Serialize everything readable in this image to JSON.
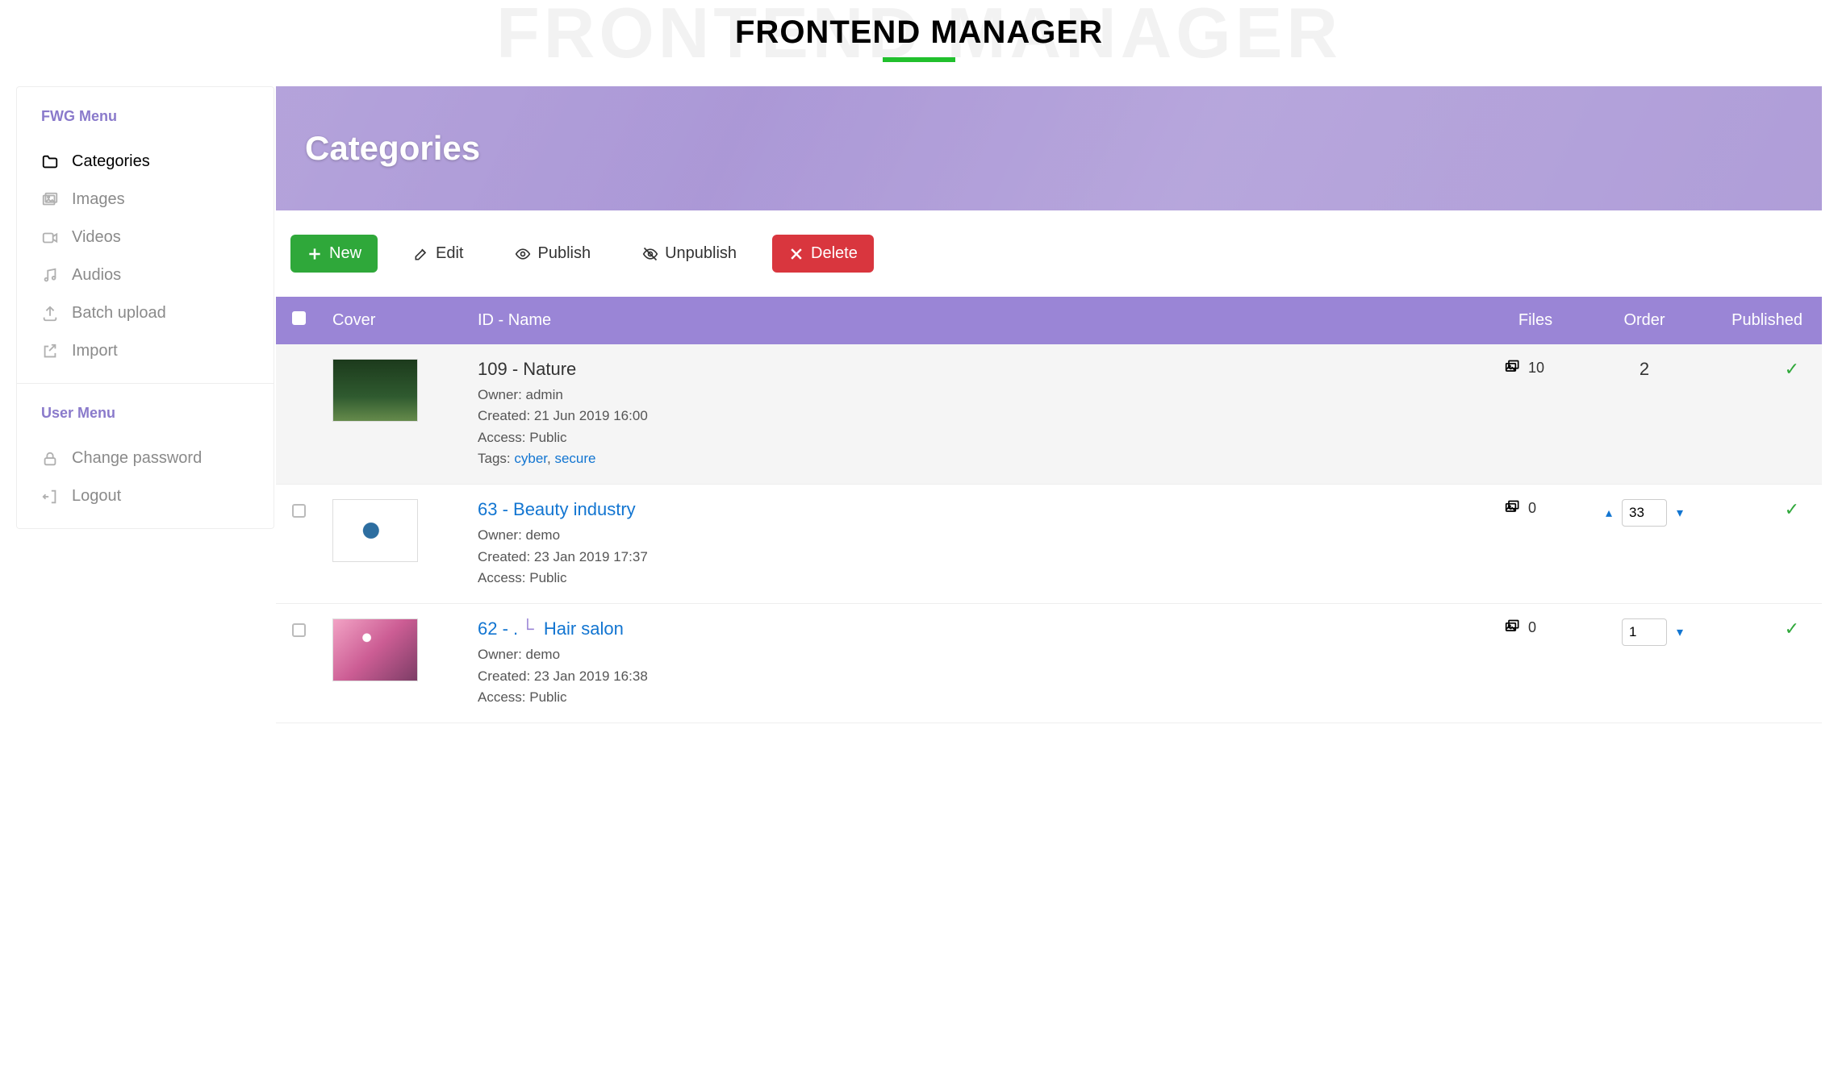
{
  "page": {
    "title": "FRONTEND MANAGER"
  },
  "sidebar": {
    "fwg_heading": "FWG Menu",
    "user_heading": "User Menu",
    "items": [
      {
        "label": "Categories",
        "icon": "folder-icon",
        "active": true
      },
      {
        "label": "Images",
        "icon": "images-icon",
        "active": false
      },
      {
        "label": "Videos",
        "icon": "video-icon",
        "active": false
      },
      {
        "label": "Audios",
        "icon": "audio-icon",
        "active": false
      },
      {
        "label": "Batch upload",
        "icon": "upload-icon",
        "active": false
      },
      {
        "label": "Import",
        "icon": "import-icon",
        "active": false
      }
    ],
    "user_items": [
      {
        "label": "Change password",
        "icon": "lock-icon"
      },
      {
        "label": "Logout",
        "icon": "logout-icon"
      }
    ]
  },
  "hero": {
    "title": "Categories"
  },
  "toolbar": {
    "new_label": "New",
    "edit_label": "Edit",
    "publish_label": "Publish",
    "unpublish_label": "Unpublish",
    "delete_label": "Delete"
  },
  "table": {
    "headers": {
      "cover": "Cover",
      "idname": "ID - Name",
      "files": "Files",
      "order": "Order",
      "published": "Published"
    },
    "rows": [
      {
        "selected": true,
        "cover_class": "cover-forest",
        "title": "109 - Nature",
        "title_link": false,
        "owner_label": "Owner: ",
        "owner": "admin",
        "created_label": "Created: ",
        "created": "21 Jun 2019 16:00",
        "access_label": "Access: ",
        "access": "Public",
        "tags_label": "Tags: ",
        "tags": [
          "cyber",
          "secure"
        ],
        "files": "10",
        "order_mode": "plain",
        "order_value": "2",
        "published": true,
        "indent": false
      },
      {
        "selected": false,
        "cover_class": "cover-eye",
        "title": "63 - Beauty industry",
        "title_link": true,
        "owner_label": "Owner: ",
        "owner": "demo",
        "created_label": "Created: ",
        "created": "23 Jan 2019 17:37",
        "access_label": "Access: ",
        "access": "Public",
        "tags_label": "",
        "tags": [],
        "files": "0",
        "order_mode": "edit_both",
        "order_value": "33",
        "published": true,
        "indent": false
      },
      {
        "selected": false,
        "cover_class": "cover-pink",
        "title_prefix": "62 - .",
        "title_suffix": "Hair salon",
        "title_link": true,
        "owner_label": "Owner: ",
        "owner": "demo",
        "created_label": "Created: ",
        "created": "23 Jan 2019 16:38",
        "access_label": "Access: ",
        "access": "Public",
        "tags_label": "",
        "tags": [],
        "files": "0",
        "order_mode": "edit_down",
        "order_value": "1",
        "published": true,
        "indent": true
      }
    ]
  }
}
